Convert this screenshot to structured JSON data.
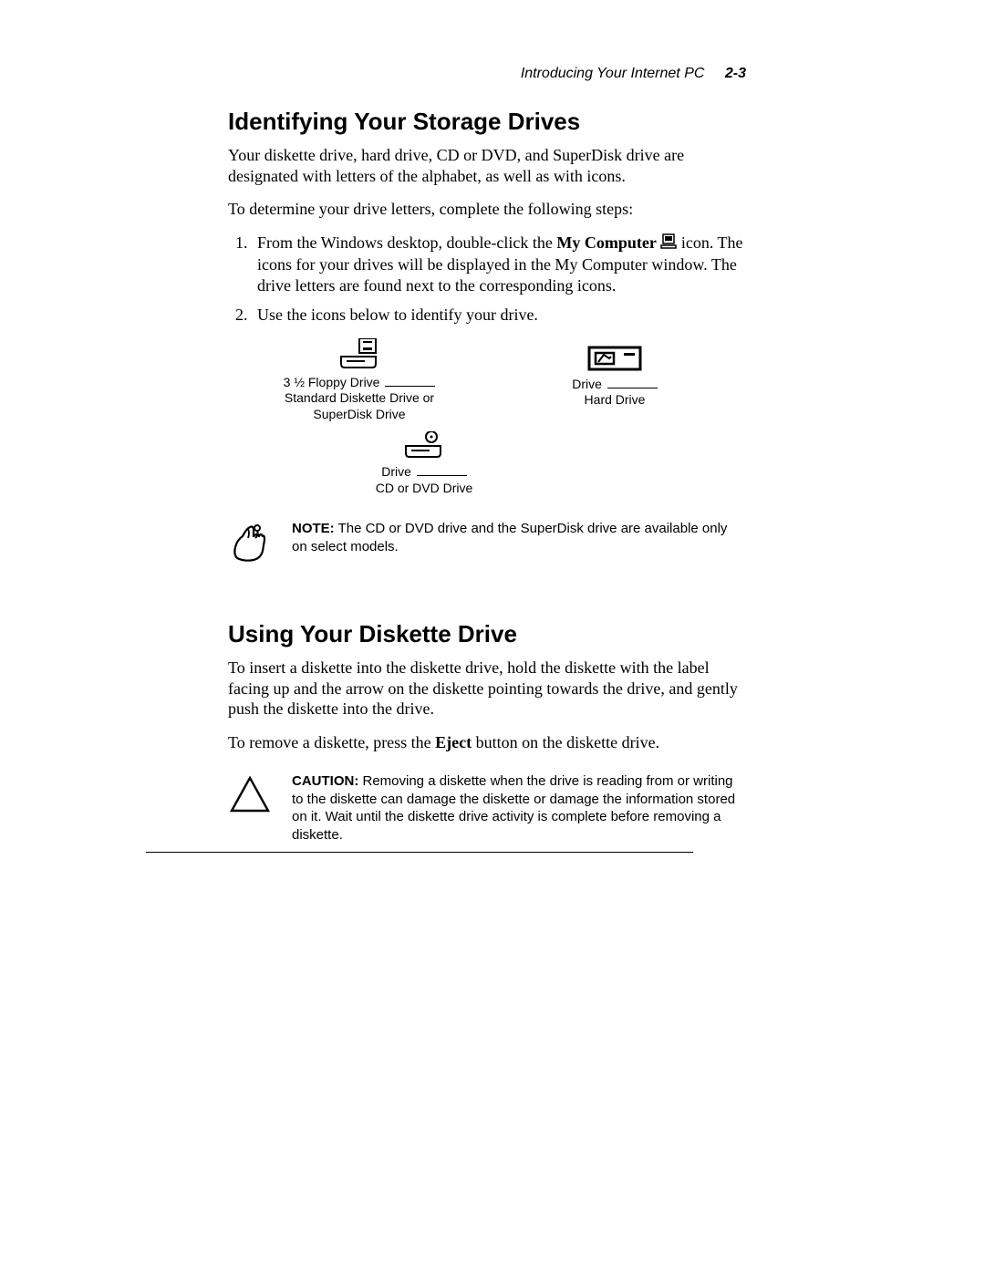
{
  "header": {
    "title": "Introducing Your Internet PC",
    "page": "2-3"
  },
  "section1": {
    "heading": "Identifying Your Storage Drives",
    "p1": "Your diskette drive, hard drive, CD or DVD, and SuperDisk drive are designated with letters of the alphabet, as well as with icons.",
    "p2": "To determine your drive letters, complete the following steps:",
    "step1_a": "From the Windows desktop, double-click the ",
    "step1_bold": "My Computer",
    "step1_b": " icon. The icons for your drives will be displayed in the My Computer window. The drive letters are found next to the corresponding icons.",
    "step2": "Use the icons below to identify your drive."
  },
  "drives": {
    "floppy_label_a": "3 ½ Floppy Drive ",
    "floppy_label_b1": "Standard Diskette Drive or",
    "floppy_label_b2": "SuperDisk Drive",
    "hard_label_a": "Drive ",
    "hard_label_b": "Hard Drive",
    "cd_label_a": "Drive ",
    "cd_label_b": "CD or DVD Drive"
  },
  "note": {
    "label": "NOTE:",
    "text": " The CD or DVD drive and the SuperDisk drive are available only on select models."
  },
  "section2": {
    "heading": "Using Your Diskette Drive",
    "p1": "To insert a diskette into the diskette drive, hold the diskette with the label facing up and the arrow on the diskette pointing towards the drive, and gently push the diskette into the drive.",
    "p2_a": "To remove a diskette, press the ",
    "p2_bold": "Eject",
    "p2_b": " button on the diskette drive."
  },
  "caution": {
    "label": "CAUTION:",
    "text": " Removing a diskette when the drive is reading from or writing to the diskette can damage the diskette or damage the information stored on it. Wait until the diskette drive activity is complete before removing a diskette."
  }
}
